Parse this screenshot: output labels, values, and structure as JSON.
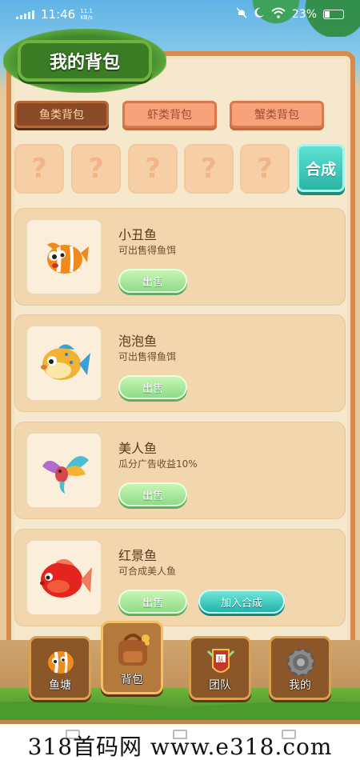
{
  "status_bar": {
    "time": "11:46",
    "speed_value": "11.1",
    "speed_unit": "KB/s",
    "battery": "23%"
  },
  "header": {
    "title": "我的背包"
  },
  "tabs": [
    {
      "label": "鱼类背包",
      "active": true
    },
    {
      "label": "虾类背包",
      "active": false
    },
    {
      "label": "蟹类背包",
      "active": false
    }
  ],
  "slots": [
    "?",
    "?",
    "?",
    "?",
    "?"
  ],
  "synthesize_label": "合成",
  "fish_list": [
    {
      "name": "小丑鱼",
      "desc": "可出售得鱼饵",
      "sell_label": "出售",
      "icon": "clownfish-icon"
    },
    {
      "name": "泡泡鱼",
      "desc": "可出售得鱼饵",
      "sell_label": "出售",
      "icon": "pufferfish-icon"
    },
    {
      "name": "美人鱼",
      "desc": "瓜分广告收益10%",
      "sell_label": "出售",
      "icon": "mermaid-fish-icon"
    },
    {
      "name": "红景鱼",
      "desc": "可合成美人鱼",
      "sell_label": "出售",
      "join_label": "加入合成",
      "icon": "red-fish-icon"
    }
  ],
  "bottom_nav": [
    {
      "label": "鱼塘",
      "icon": "fishpond-icon",
      "active": false
    },
    {
      "label": "背包",
      "icon": "backpack-icon",
      "active": true
    },
    {
      "label": "团队",
      "icon": "team-icon",
      "active": false
    },
    {
      "label": "我的",
      "icon": "gear-icon",
      "active": false
    }
  ],
  "watermark": "318首码网 www.e318.com",
  "colors": {
    "panel_border": "#d98a4a",
    "panel_bg": "#f6e8cc",
    "tab_active": "#8a4a25",
    "tab_inactive": "#f7a27a",
    "sell_button": "#8fdc8a",
    "synth_button": "#2bb4a6",
    "banner_green": "#3b7d25"
  }
}
